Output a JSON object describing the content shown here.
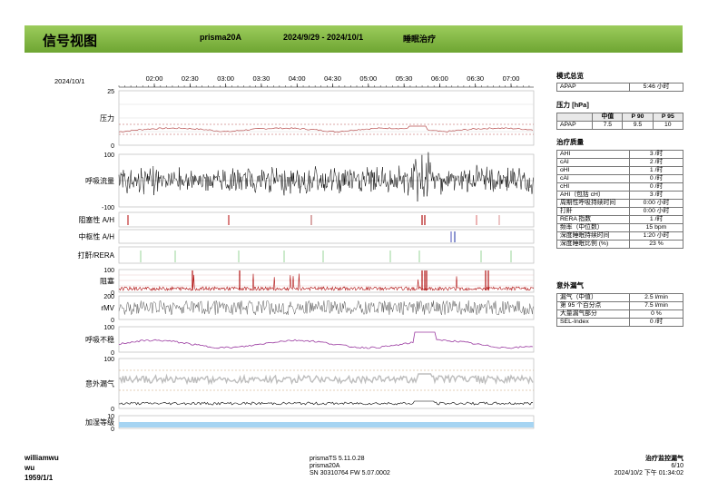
{
  "header": {
    "title": "信号视图",
    "device": "prisma20A",
    "date_range": "2024/9/29 - 2024/10/1",
    "mode": "睡眠治疗"
  },
  "chart_area": {
    "date": "2024/10/1",
    "time_ticks": [
      "02:00",
      "02:30",
      "03:00",
      "03:30",
      "04:00",
      "04:30",
      "05:00",
      "05:30",
      "06:00",
      "06:30",
      "07:00"
    ],
    "tracks": [
      {
        "label": "压力",
        "ymax": "25",
        "ymin": "0"
      },
      {
        "label": "呼吸流量",
        "ymax": "100",
        "ymin": "-100"
      },
      {
        "label": "阻塞性 A/H"
      },
      {
        "label": "中枢性 A/H"
      },
      {
        "label": "打鼾/RERA"
      },
      {
        "label": "阻塞",
        "ymax": "100",
        "ymin": "0"
      },
      {
        "label": "rMV",
        "ymax": "200",
        "ymin": "0"
      },
      {
        "label": "呼吸不稳",
        "ymax": "100",
        "ymin": "0"
      },
      {
        "label": "意外漏气",
        "ymax": "100",
        "ymin": "0"
      },
      {
        "label": "加湿等级",
        "ymax": "10",
        "ymin": "0"
      }
    ]
  },
  "mode_overview": {
    "title": "模式总览",
    "rows": [
      {
        "label": "APAP",
        "value": "5:46 小时"
      }
    ]
  },
  "pressure": {
    "title": "压力 [hPa]",
    "headers": [
      "",
      "中值",
      "P 90",
      "P 95"
    ],
    "rows": [
      [
        "APAP",
        "7.5",
        "9.5",
        "10"
      ]
    ]
  },
  "therapy_quality": {
    "title": "治疗质量",
    "rows": [
      {
        "label": "AHI",
        "value": "3 /时"
      },
      {
        "label": "cAI",
        "value": "2 /时"
      },
      {
        "label": "oHI",
        "value": "1 /时"
      },
      {
        "label": "cAI",
        "value": "0 /时"
      },
      {
        "label": "cHI",
        "value": "0 /时"
      },
      {
        "label": "AHI（包括 cH）",
        "value": "3 /时"
      },
      {
        "label": "周期性呼吸持续时间",
        "value": "0:00 小时"
      },
      {
        "label": "打鼾",
        "value": "0:00 小时"
      },
      {
        "label": "RERA 指数",
        "value": "1 /时"
      },
      {
        "label": "频率（中位数）",
        "value": "15 bpm"
      },
      {
        "label": "深度睡眠持续时间",
        "value": "1:20 小时"
      },
      {
        "label": "深度睡眠比例 (%)",
        "value": "23 %"
      }
    ]
  },
  "leak": {
    "title": "意外漏气",
    "rows": [
      {
        "label": "漏气（中值）",
        "value": "2.5 l/min"
      },
      {
        "label": "第 95 个百分点",
        "value": "7.5 l/min"
      },
      {
        "label": "大量漏气部分",
        "value": "0 %"
      },
      {
        "label": "SEL-Index",
        "value": "0 /时"
      }
    ]
  },
  "footer": {
    "user": "williamwu",
    "name": "wu",
    "dob": "1959/1/1",
    "software": "prismaTS 5.11.0.28",
    "device": "prisma20A",
    "serial": "SN 30310764 FW 5.07.0002",
    "report": "治疗监控漏气",
    "page": "6/10",
    "printed": "2024/10/2 下午 01:34:02"
  },
  "colors": {
    "banner": "#8bbf4a",
    "pressure": "#b85050",
    "flow": "#000000",
    "obstruction": "#b01010",
    "rmv": "#555555",
    "instability": "#9a3aa0",
    "leak": "#bdbdbd",
    "humidifier": "#a6d4f2"
  }
}
